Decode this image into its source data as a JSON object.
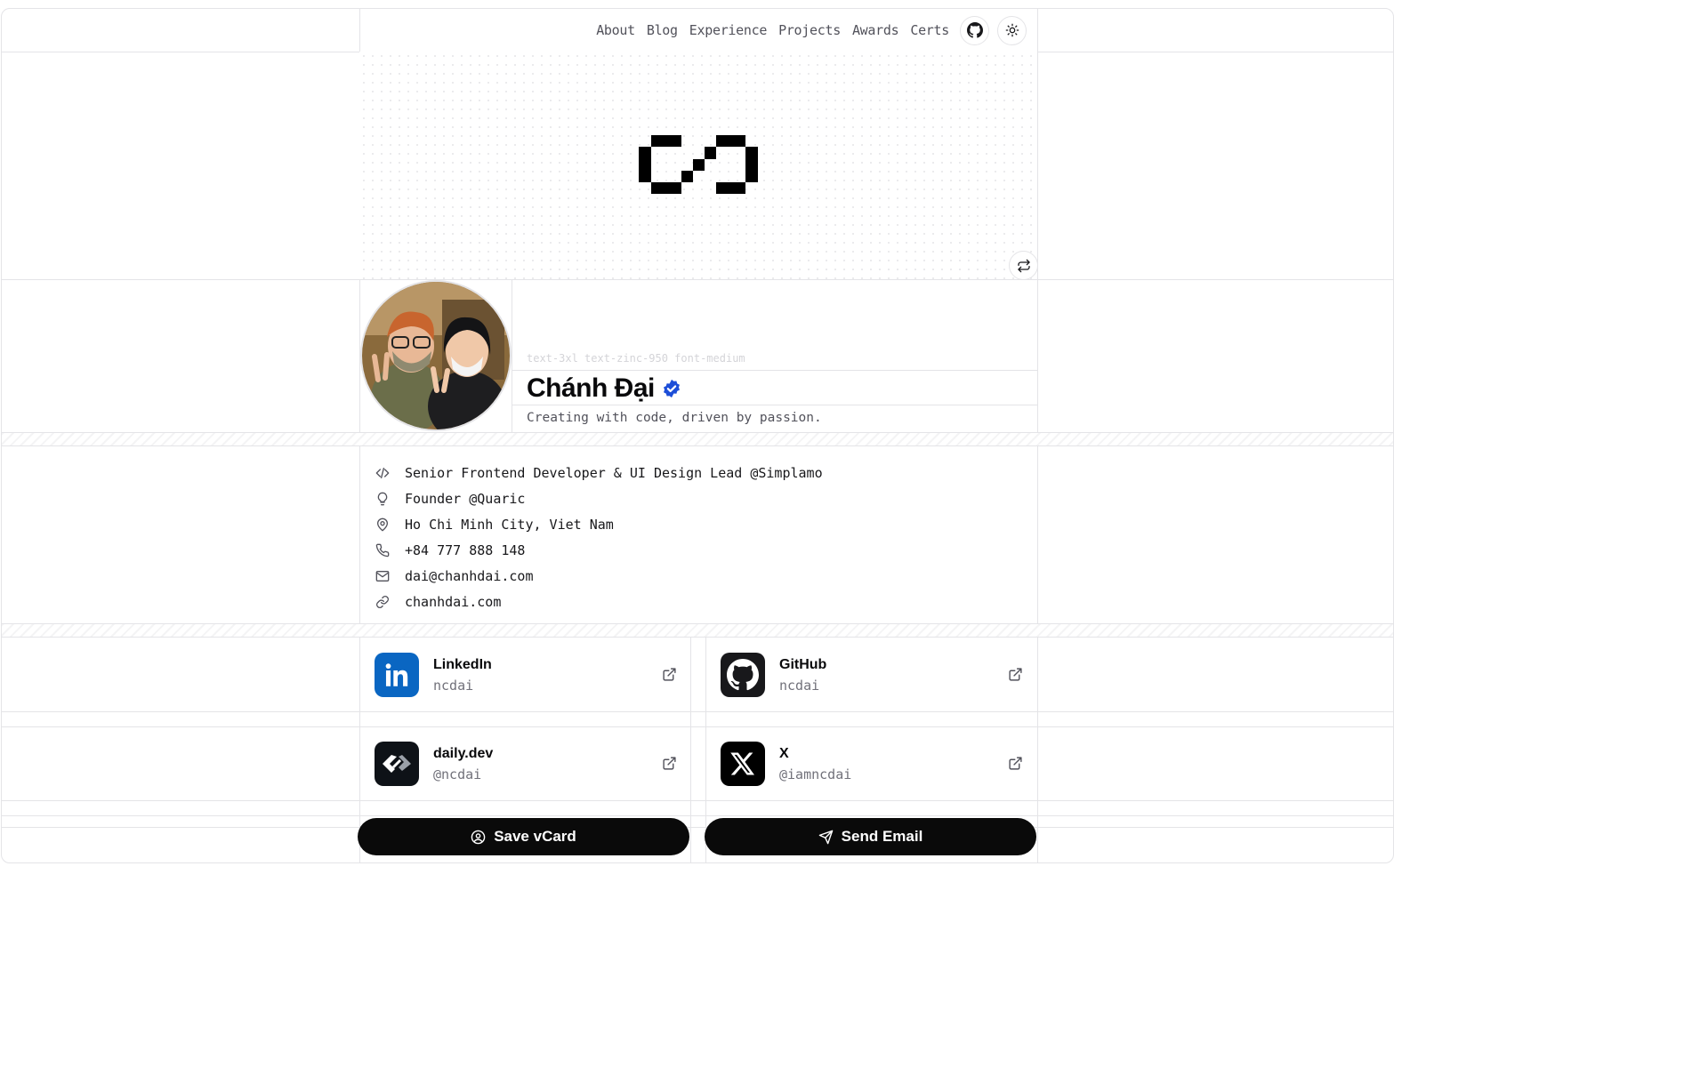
{
  "nav": {
    "links": [
      "About",
      "Blog",
      "Experience",
      "Projects",
      "Awards",
      "Certs"
    ],
    "github_icon": "github-icon",
    "theme_icon": "sun-icon"
  },
  "hero": {
    "swap_icon": "repeat-icon"
  },
  "profile": {
    "hint": "text-3xl text-zinc-950 font-medium",
    "name": "Chánh Đại",
    "verified_icon": "verified-badge-icon",
    "tagline": "Creating with code, driven by passion."
  },
  "info": {
    "items": [
      {
        "icon": "code-icon",
        "text": "Senior Frontend Developer & UI Design Lead @Simplamo"
      },
      {
        "icon": "lightbulb-icon",
        "text": "Founder @Quaric"
      },
      {
        "icon": "map-pin-icon",
        "text": "Ho Chi Minh City, Viet Nam"
      },
      {
        "icon": "phone-icon",
        "text": "+84 777 888 148"
      },
      {
        "icon": "mail-icon",
        "text": "dai@chanhdai.com"
      },
      {
        "icon": "link-icon",
        "text": "chanhdai.com"
      }
    ]
  },
  "social": [
    {
      "title": "LinkedIn",
      "handle": "ncdai",
      "color": "#0a66c2"
    },
    {
      "title": "GitHub",
      "handle": "ncdai",
      "color": "#18181b"
    },
    {
      "title": "daily.dev",
      "handle": "@ncdai",
      "color": "#0e1217"
    },
    {
      "title": "X",
      "handle": "@iamncdai",
      "color": "#000000"
    }
  ],
  "actions": {
    "save": "Save vCard",
    "email": "Send Email"
  }
}
